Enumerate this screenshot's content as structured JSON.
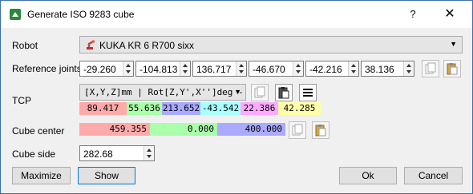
{
  "window": {
    "title": "Generate ISO 9283 cube",
    "help_label": "?",
    "close_label": "✕"
  },
  "robot": {
    "label": "Robot",
    "value": "KUKA KR 6 R700 sixx"
  },
  "reference_joints": {
    "label": "Reference joints",
    "values": [
      "-29.260",
      "-104.813",
      "136.717",
      "-46.670",
      "-42.216",
      "38.136"
    ]
  },
  "tcp": {
    "label": "TCP",
    "format": "[X,Y,Z]mm | Rot[Z,Y',X'']deg -",
    "values": [
      "89.417",
      "55.636",
      "213.652",
      "-43.542",
      "22.386",
      "42.285"
    ],
    "colors": [
      "#ffaaaa",
      "#aaffaa",
      "#aaaaff",
      "#aaffff",
      "#ffaaff",
      "#ffffaa"
    ]
  },
  "cube_center": {
    "label": "Cube center",
    "values": [
      "459.355",
      "0.000",
      "400.000"
    ],
    "colors": [
      "#ffaaaa",
      "#aaffaa",
      "#aaaaff"
    ]
  },
  "cube_side": {
    "label": "Cube side",
    "value": "282.68"
  },
  "buttons": {
    "maximize": "Maximize",
    "show": "Show",
    "ok": "Ok",
    "cancel": "Cancel"
  }
}
